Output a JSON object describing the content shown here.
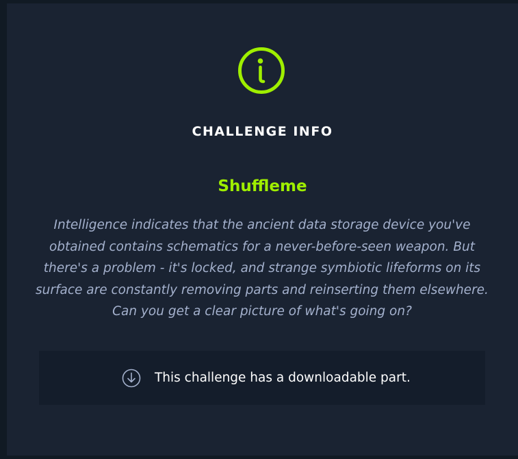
{
  "modal": {
    "info_icon": "info-circle-icon",
    "heading": "CHALLENGE INFO",
    "challenge_name": "Shuffleme",
    "description": "Intelligence indicates that the ancient data storage device you've obtained contains schematics for a never-before-seen weapon. But there's a problem - it's locked, and strange symbiotic lifeforms on its surface are constantly removing parts and reinserting them elsewhere. Can you get a clear picture of what's going on?",
    "download": {
      "icon": "download-circle-icon",
      "text": "This challenge has a downloadable part."
    }
  },
  "colors": {
    "accent": "#9fef00",
    "modal_bg": "#1a2332",
    "panel_bg": "#141d2b",
    "description_text": "#a4b1cd",
    "heading_text": "#ffffff"
  }
}
